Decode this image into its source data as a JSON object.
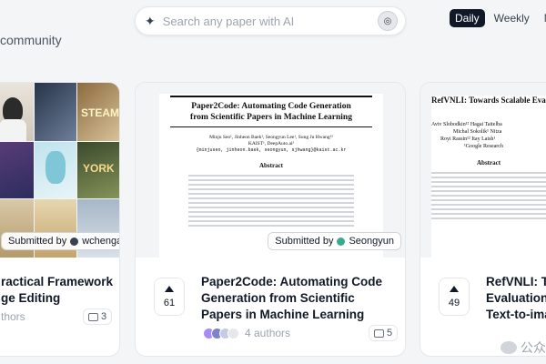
{
  "header": {
    "brand_fragment": "community",
    "search_placeholder": "Search any paper with AI",
    "period_tabs": [
      {
        "label": "Daily",
        "active": true
      },
      {
        "label": "Weekly",
        "active": false
      },
      {
        "label": "Mor",
        "active": false
      }
    ]
  },
  "cards": [
    {
      "submitted_label": "Submitted by",
      "submitter": "wchengad",
      "title_lines": [
        "ractical Framework",
        "ge Editing"
      ],
      "authors_label": "thors",
      "comments": "3",
      "collage": {
        "tile_text_1": "STEAM",
        "tile_text_2": "YORK"
      }
    },
    {
      "submitted_label": "Submitted by",
      "submitter": "Seongyun",
      "votes": "61",
      "title_lines": [
        "Paper2Code: Automating Code",
        "Generation from Scientific",
        "Papers in Machine Learning"
      ],
      "authors_label": "4 authors",
      "comments": "5",
      "preview": {
        "title_line1": "Paper2Code: Automating Code Generation",
        "title_line2": "from Scientific Papers in Machine Learning",
        "authors": "Minju Seo¹, Jinheon Baek¹, Seongyun Lee¹, Sung Ju Hwang¹²",
        "affiliation": "KAIST¹, DeepAuto.ai²",
        "emails": "{minjuseo, jinheon.baek, seongyun, sjhwang}@kaist.ac.kr",
        "abstract_heading": "Abstract"
      }
    },
    {
      "votes": "49",
      "title_lines": [
        "RefVNLI: To",
        "Evaluation o",
        "Text-to-ima"
      ],
      "preview": {
        "title": "RefVNLI: Towards Scalable Eva",
        "authors_line1": "Aviv Slobodkin¹²   Hagai Taitelba",
        "authors_line2": "Michal Sokolik¹   Nitza",
        "authors_line3": "Royi Rassin¹²   Itay Laish¹",
        "affiliation": "¹Google Research",
        "abstract_heading": "Abstract"
      },
      "watermark": "公众"
    }
  ],
  "colors": {
    "background": "#f4f5f7",
    "card": "#ffffff",
    "active_tab": "#111827",
    "border": "#e5e7eb"
  }
}
